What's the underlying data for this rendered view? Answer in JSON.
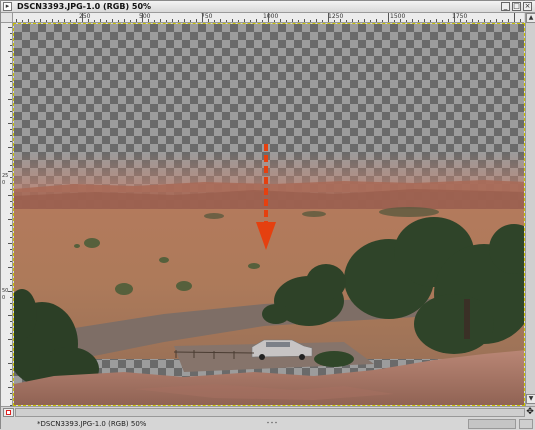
{
  "window": {
    "title": "DSCN3393.JPG-1.0 (RGB) 50%",
    "menu_icon": "image-menu-icon",
    "controls": {
      "minimize": "_",
      "maximize": "□",
      "close": "×"
    }
  },
  "ruler": {
    "h_labels": [
      "250",
      "500",
      "750",
      "1000",
      "1250",
      "1500",
      "1750"
    ],
    "v_labels": [
      "0",
      "250",
      "500",
      "750"
    ]
  },
  "canvas": {
    "transparent_pattern": "checkerboard",
    "arrow_color": "#e5400f",
    "arrow_icon": "arrow-down-dashed-icon"
  },
  "status": {
    "text": "*DSCN3393.JPG-1.0 (RGB) 50%",
    "quick_mask_icon": "quick-mask-icon",
    "navigate_icon": "navigate-move-icon"
  }
}
